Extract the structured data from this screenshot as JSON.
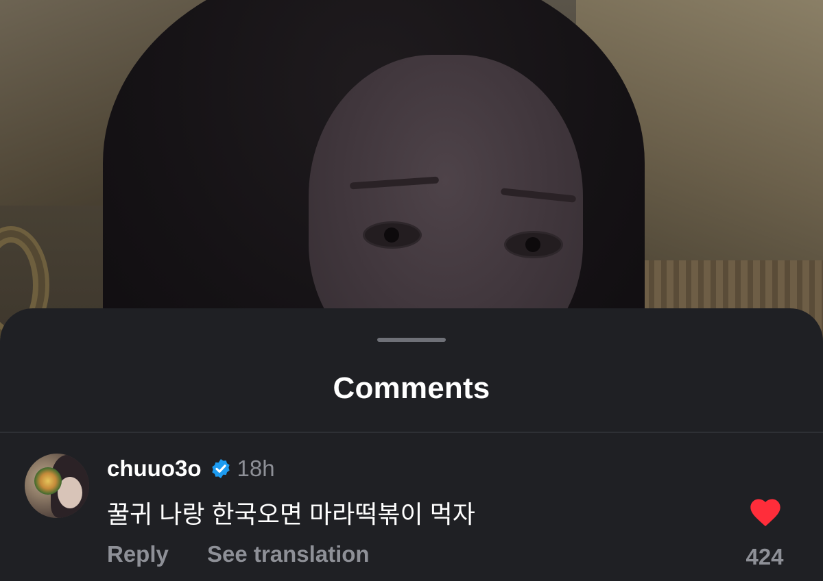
{
  "sheet": {
    "title": "Comments"
  },
  "comment": {
    "username": "chuuo3o",
    "verified": true,
    "time": "18h",
    "text": "꿀귀 나랑 한국오면 마라떡볶이 먹자",
    "actions": {
      "reply": "Reply",
      "translate": "See translation"
    },
    "likes": "424",
    "liked": true
  },
  "colors": {
    "sheet_bg": "#1f2024",
    "secondary_text": "#8e9097",
    "verified_blue": "#1d9bf0",
    "like_red": "#ff2d3a"
  }
}
